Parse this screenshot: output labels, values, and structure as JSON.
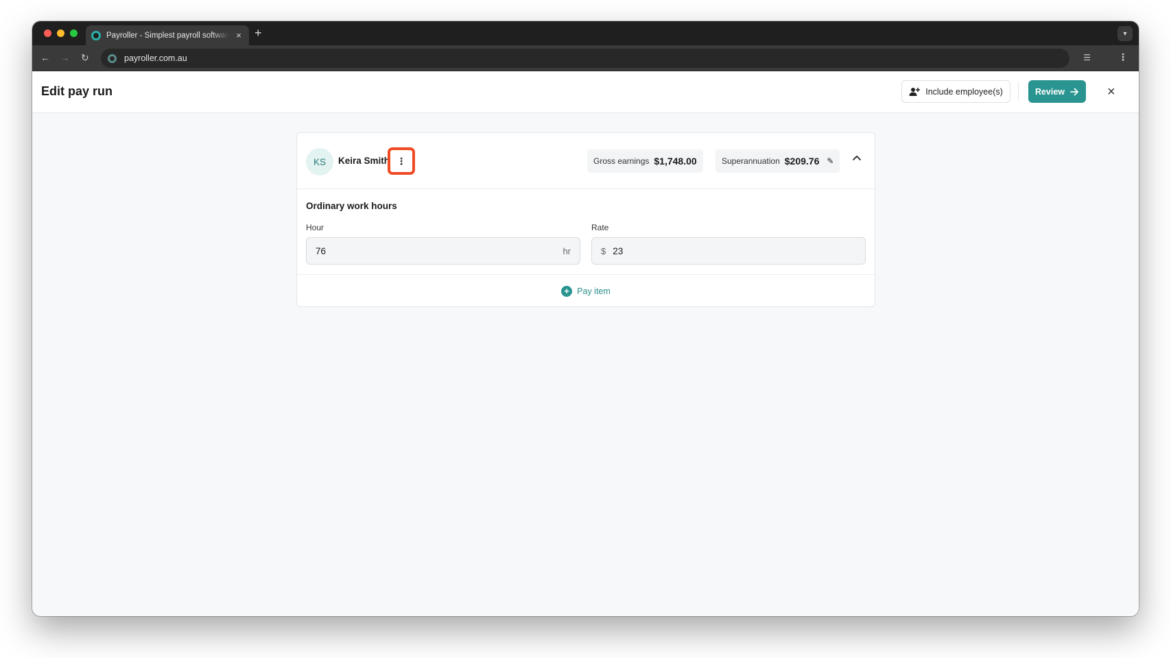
{
  "browser": {
    "tab_title": "Payroller - Simplest payroll software",
    "tab_close": "×",
    "new_tab": "+",
    "url": "payroller.com.au"
  },
  "header": {
    "title": "Edit pay run",
    "include_label": "Include employee(s)",
    "review_label": "Review",
    "close": "×"
  },
  "employee": {
    "initials": "KS",
    "name": "Keira Smith",
    "gross_label": "Gross earnings",
    "gross_value": "$1,748.00",
    "super_label": "Superannuation",
    "super_value": "$209.76"
  },
  "ordinary": {
    "title": "Ordinary work hours",
    "hour_label": "Hour",
    "hour_value": "76",
    "hour_unit": "hr",
    "rate_label": "Rate",
    "rate_currency": "$",
    "rate_value": "23"
  },
  "footer": {
    "pay_item_label": "Pay item"
  },
  "colors": {
    "accent": "#2a9490",
    "highlight": "#f04a23"
  }
}
